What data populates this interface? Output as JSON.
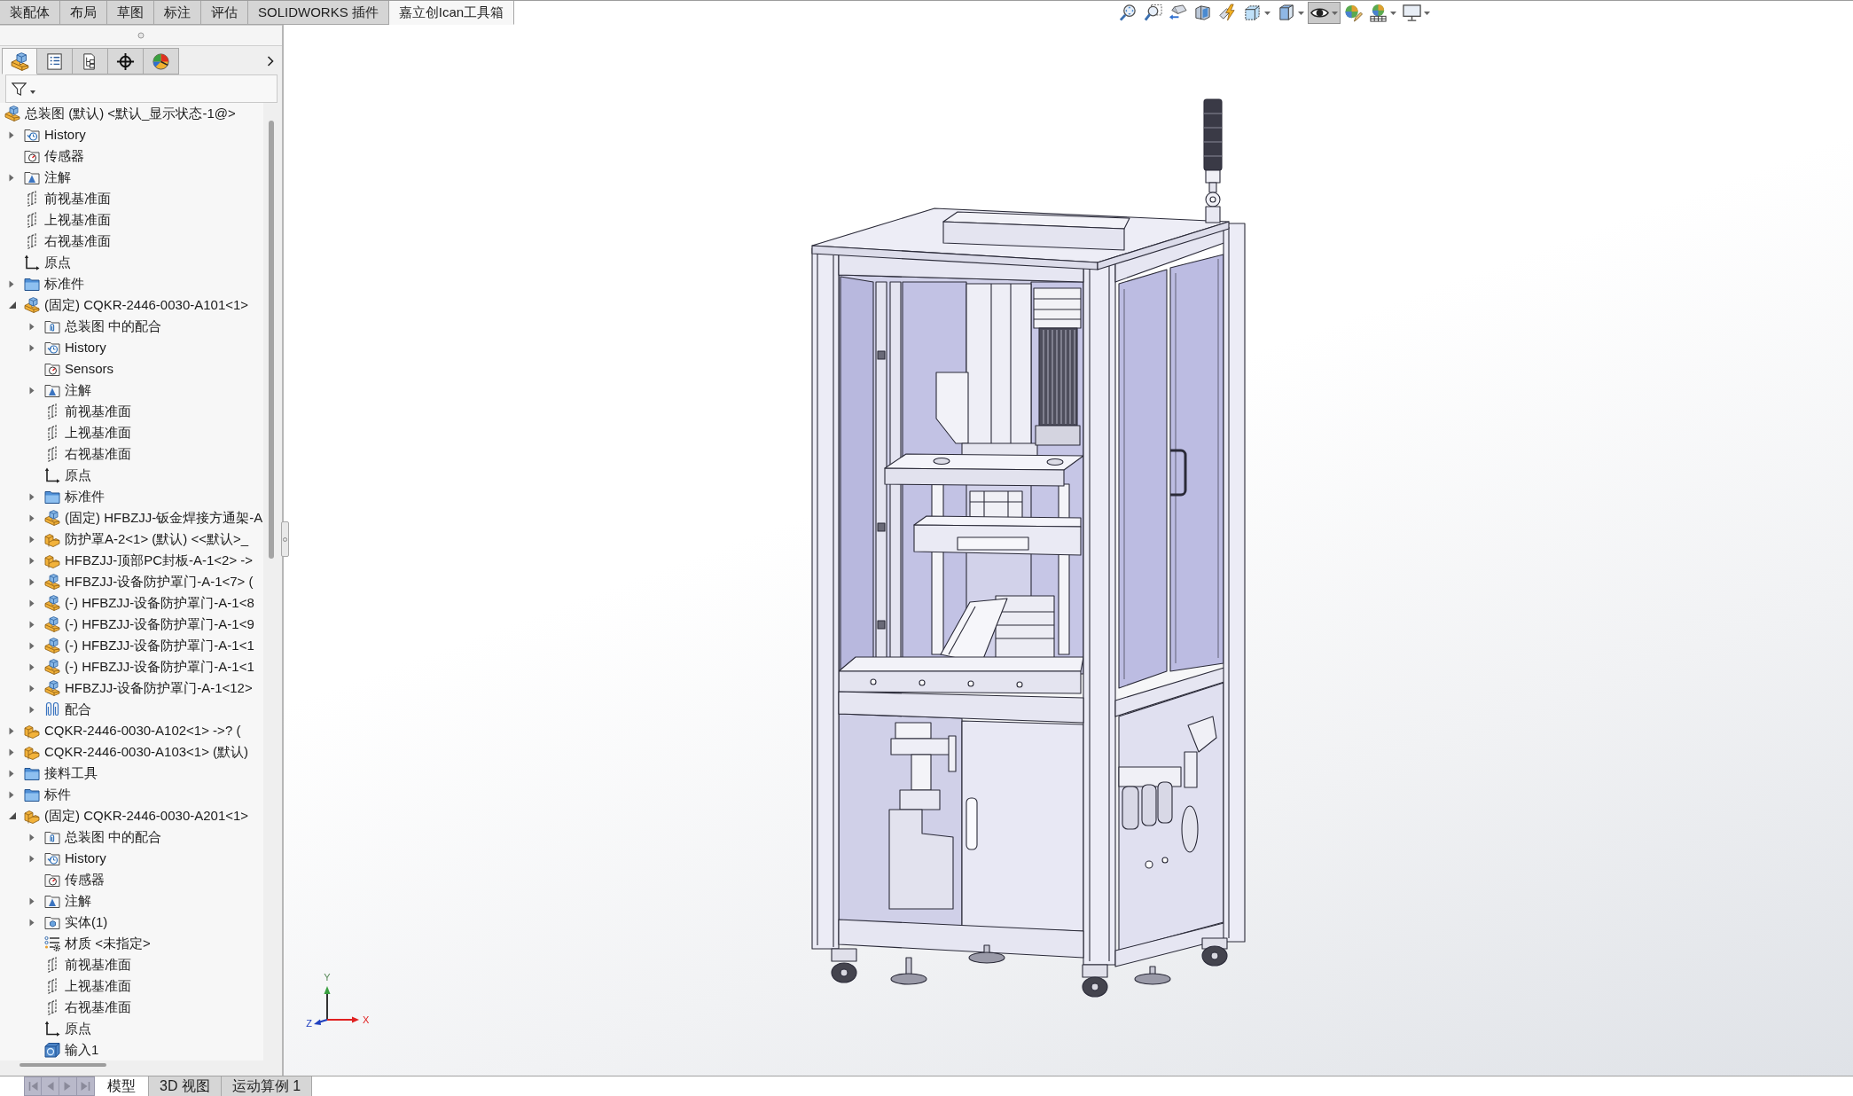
{
  "command_tabs": [
    {
      "label": "装配体",
      "selected": false
    },
    {
      "label": "布局",
      "selected": false
    },
    {
      "label": "草图",
      "selected": false
    },
    {
      "label": "标注",
      "selected": false
    },
    {
      "label": "评估",
      "selected": false
    },
    {
      "label": "SOLIDWORKS 插件",
      "selected": false
    },
    {
      "label": "嘉立创Ican工具箱",
      "selected": true
    }
  ],
  "view_toolbar": [
    {
      "kind": "zoomfit",
      "pressed": false,
      "menu": false
    },
    {
      "kind": "zoomarea",
      "pressed": false,
      "menu": false
    },
    {
      "kind": "previousview",
      "pressed": false,
      "menu": false
    },
    {
      "kind": "section",
      "pressed": false,
      "menu": false
    },
    {
      "kind": "annotationviews",
      "pressed": false,
      "menu": false
    },
    {
      "kind": "orientation",
      "pressed": false,
      "menu": true
    },
    {
      "kind": "displaystyle",
      "pressed": false,
      "menu": true
    },
    {
      "kind": "hideshow",
      "pressed": true,
      "menu": true
    },
    {
      "kind": "appearance",
      "pressed": false,
      "menu": false
    },
    {
      "kind": "scene",
      "pressed": false,
      "menu": true
    },
    {
      "kind": "viewsettings",
      "pressed": false,
      "menu": true
    }
  ],
  "panel_tabs": [
    {
      "kind": "featuretree",
      "selected": true
    },
    {
      "kind": "properties",
      "selected": false
    },
    {
      "kind": "configurations",
      "selected": false
    },
    {
      "kind": "dimxpert",
      "selected": false
    },
    {
      "kind": "display",
      "selected": false
    }
  ],
  "tree": {
    "items": [
      {
        "label": "总装图 (默认) <默认_显示状态-1@>",
        "kind": "assembly",
        "children": [
          {
            "label": "History",
            "kind": "history",
            "expanded": false
          },
          {
            "label": "传感器",
            "kind": "sensors"
          },
          {
            "label": "注解",
            "kind": "annotations",
            "expanded": false
          },
          {
            "label": "前视基准面",
            "kind": "plane"
          },
          {
            "label": "上视基准面",
            "kind": "plane"
          },
          {
            "label": "右视基准面",
            "kind": "plane"
          },
          {
            "label": "原点",
            "kind": "origin"
          },
          {
            "label": "标准件",
            "kind": "folder",
            "expanded": false
          },
          {
            "label": "(固定) CQKR-2446-0030-A101<1>",
            "kind": "assembly",
            "expanded": true,
            "children": [
              {
                "label": "总装图 中的配合",
                "kind": "matefolder",
                "expanded": false
              },
              {
                "label": "History",
                "kind": "history",
                "expanded": false
              },
              {
                "label": "Sensors",
                "kind": "sensors"
              },
              {
                "label": "注解",
                "kind": "annotations",
                "expanded": false
              },
              {
                "label": "前视基准面",
                "kind": "plane"
              },
              {
                "label": "上视基准面",
                "kind": "plane"
              },
              {
                "label": "右视基准面",
                "kind": "plane"
              },
              {
                "label": "原点",
                "kind": "origin"
              },
              {
                "label": "标准件",
                "kind": "folder",
                "expanded": false
              },
              {
                "label": "(固定) HFBZJJ-钣金焊接方通架-A",
                "kind": "assembly",
                "expanded": false
              },
              {
                "label": "防护罩A-2<1> (默认) <<默认>_",
                "kind": "part",
                "expanded": false
              },
              {
                "label": "HFBZJJ-顶部PC封板-A-1<2> ->",
                "kind": "part",
                "expanded": false
              },
              {
                "label": "HFBZJJ-设备防护罩门-A-1<7> (",
                "kind": "assembly",
                "expanded": false
              },
              {
                "label": "(-) HFBZJJ-设备防护罩门-A-1<8",
                "kind": "assembly",
                "expanded": false
              },
              {
                "label": "(-) HFBZJJ-设备防护罩门-A-1<9",
                "kind": "assembly",
                "expanded": false
              },
              {
                "label": "(-) HFBZJJ-设备防护罩门-A-1<1",
                "kind": "assembly",
                "expanded": false
              },
              {
                "label": "(-) HFBZJJ-设备防护罩门-A-1<1",
                "kind": "assembly",
                "expanded": false
              },
              {
                "label": "HFBZJJ-设备防护罩门-A-1<12>",
                "kind": "assembly",
                "expanded": false
              },
              {
                "label": "配合",
                "kind": "mates",
                "expanded": false
              }
            ]
          },
          {
            "label": "CQKR-2446-0030-A102<1> ->? (",
            "kind": "part",
            "expanded": false
          },
          {
            "label": "CQKR-2446-0030-A103<1> (默认)",
            "kind": "part",
            "expanded": false
          },
          {
            "label": "接料工具",
            "kind": "folder",
            "expanded": false
          },
          {
            "label": "标件",
            "kind": "folder",
            "expanded": false
          },
          {
            "label": "(固定) CQKR-2446-0030-A201<1>",
            "kind": "part",
            "expanded": true,
            "children": [
              {
                "label": "总装图 中的配合",
                "kind": "matefolder",
                "expanded": false
              },
              {
                "label": "History",
                "kind": "history",
                "expanded": false
              },
              {
                "label": "传感器",
                "kind": "sensors"
              },
              {
                "label": "注解",
                "kind": "annotations",
                "expanded": false
              },
              {
                "label": "实体(1)",
                "kind": "bodies",
                "expanded": false
              },
              {
                "label": "材质 <未指定>",
                "kind": "material"
              },
              {
                "label": "前视基准面",
                "kind": "plane"
              },
              {
                "label": "上视基准面",
                "kind": "plane"
              },
              {
                "label": "右视基准面",
                "kind": "plane"
              },
              {
                "label": "原点",
                "kind": "origin"
              },
              {
                "label": "输入1",
                "kind": "import"
              }
            ]
          }
        ]
      }
    ]
  },
  "triad": {
    "x_label": "X",
    "y_label": "Y",
    "z_label": "Z"
  },
  "sheet_tabs": [
    {
      "label": "模型",
      "selected": true
    },
    {
      "label": "3D 视图",
      "selected": false
    },
    {
      "label": "运动算例 1",
      "selected": false
    }
  ]
}
